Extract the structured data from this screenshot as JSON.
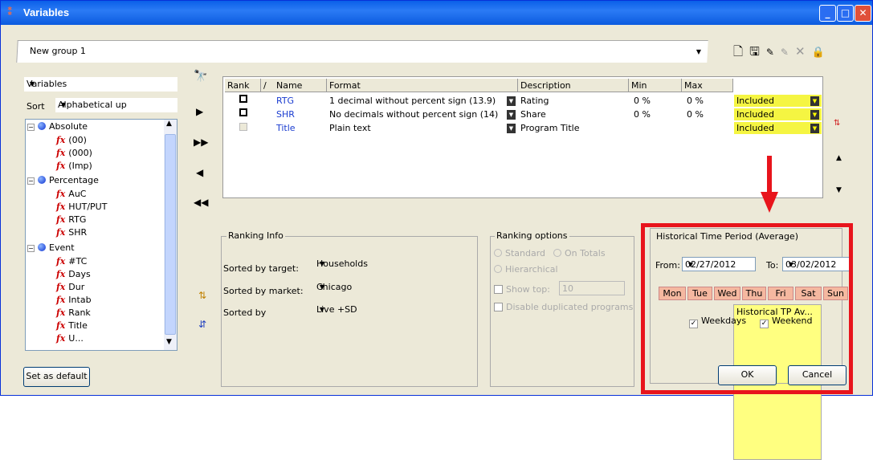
{
  "window": {
    "title": "Variables",
    "icon": "variables-app-icon"
  },
  "group": {
    "name": "New group 1"
  },
  "toolbar": {
    "icons": [
      "new-icon",
      "save-icon",
      "save-as-icon",
      "edit-icon",
      "delete-icon",
      "lock-icon"
    ]
  },
  "left": {
    "dropdown": "Variables",
    "sort_label": "Sort",
    "sort_value": "Alphabetical up",
    "tree": [
      {
        "label": "Absolute",
        "level": 0,
        "type": "group"
      },
      {
        "label": "(00)",
        "level": 1,
        "type": "var"
      },
      {
        "label": "(000)",
        "level": 1,
        "type": "var"
      },
      {
        "label": "(Imp)",
        "level": 1,
        "type": "var"
      },
      {
        "label": "Percentage",
        "level": 0,
        "type": "group"
      },
      {
        "label": "AuC",
        "level": 1,
        "type": "var"
      },
      {
        "label": "HUT/PUT",
        "level": 1,
        "type": "var"
      },
      {
        "label": "RTG",
        "level": 1,
        "type": "var"
      },
      {
        "label": "SHR",
        "level": 1,
        "type": "var"
      },
      {
        "label": "Event",
        "level": 0,
        "type": "group"
      },
      {
        "label": "#TC",
        "level": 1,
        "type": "var"
      },
      {
        "label": "Days",
        "level": 1,
        "type": "var"
      },
      {
        "label": "Dur",
        "level": 1,
        "type": "var"
      },
      {
        "label": "Intab",
        "level": 1,
        "type": "var"
      },
      {
        "label": "Rank",
        "level": 1,
        "type": "var"
      },
      {
        "label": "Title",
        "level": 1,
        "type": "var"
      },
      {
        "label": "U...",
        "level": 1,
        "type": "var"
      }
    ],
    "set_default": "Set as default"
  },
  "grid": {
    "headers": {
      "rank": "Rank",
      "sort": "/",
      "name": "Name",
      "format": "Format",
      "description": "Description",
      "min": "Min",
      "max": "Max",
      "hist": "Historical TP Av..."
    },
    "rows": [
      {
        "name": "RTG",
        "format": "1 decimal without percent sign (13.9)",
        "description": "Rating",
        "min": "0 %",
        "max": "0 %",
        "hist": "Included"
      },
      {
        "name": "SHR",
        "format": "No decimals without percent sign (14)",
        "description": "Share",
        "min": "0 %",
        "max": "0 %",
        "hist": "Included"
      },
      {
        "name": "Title",
        "format": "Plain text",
        "description": "Program Title",
        "min": "",
        "max": "",
        "hist": "Included"
      }
    ]
  },
  "ranking_info": {
    "title": "Ranking Info",
    "target_label": "Sorted by target:",
    "target_value": "Households",
    "market_label": "Sorted by market:",
    "market_value": "Chicago",
    "by_label": "Sorted by",
    "by_value": "Live +SD"
  },
  "ranking_options": {
    "title": "Ranking options",
    "standard": "Standard",
    "on_totals": "On Totals",
    "hierarchical": "Hierarchical",
    "show_top": "Show top:",
    "show_top_value": "10",
    "disable_dup": "Disable duplicated programs"
  },
  "historical": {
    "title": "Historical Time Period (Average)",
    "from_label": "From:",
    "from_value": "02/27/2012",
    "to_label": "To:",
    "to_value": "03/02/2012",
    "days": [
      "Mon",
      "Tue",
      "Wed",
      "Thu",
      "Fri",
      "Sat",
      "Sun"
    ],
    "weekdays": "Weekdays",
    "weekend": "Weekend"
  },
  "buttons": {
    "ok": "OK",
    "cancel": "Cancel"
  }
}
